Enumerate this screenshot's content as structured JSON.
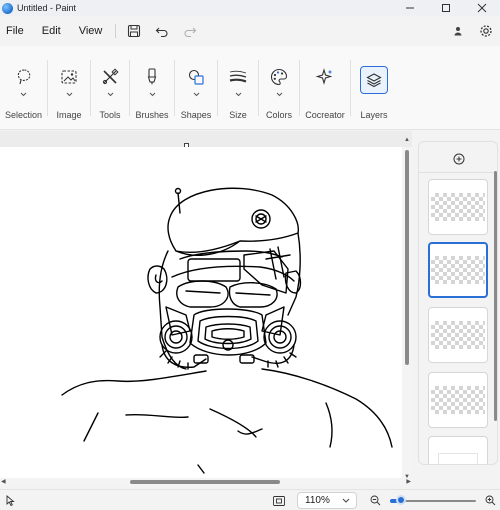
{
  "window": {
    "title": "Untitled - Paint",
    "controls": [
      "minimize",
      "maximize",
      "close"
    ]
  },
  "menu": {
    "items": [
      "File",
      "Edit",
      "View"
    ],
    "quick_actions": [
      "save-icon",
      "undo-icon",
      "redo-icon"
    ],
    "right_icons": [
      "account-icon",
      "settings-icon"
    ]
  },
  "ribbon": {
    "groups": [
      {
        "label": "Selection",
        "icon": "selection-lasso-icon",
        "has_dropdown": true
      },
      {
        "label": "Image",
        "icon": "image-icon",
        "has_dropdown": true
      },
      {
        "label": "Tools",
        "icon": "tools-icon",
        "has_dropdown": true
      },
      {
        "label": "Brushes",
        "icon": "brush-icon",
        "has_dropdown": true
      },
      {
        "label": "Shapes",
        "icon": "shapes-icon",
        "has_dropdown": true
      },
      {
        "label": "Size",
        "icon": "size-lines-icon",
        "has_dropdown": true
      },
      {
        "label": "Colors",
        "icon": "palette-icon",
        "has_dropdown": true
      },
      {
        "label": "Cocreator",
        "icon": "sparkle-icon",
        "has_dropdown": false
      },
      {
        "label": "Layers",
        "icon": "layers-icon",
        "has_dropdown": false,
        "active": true
      }
    ]
  },
  "layers_panel": {
    "add_icon": "add-layer-icon",
    "layers": [
      {
        "type": "transparent",
        "selected": false
      },
      {
        "type": "transparent",
        "selected": true
      },
      {
        "type": "transparent",
        "selected": false
      },
      {
        "type": "transparent",
        "selected": false
      },
      {
        "type": "white-background",
        "selected": false
      }
    ]
  },
  "statusbar": {
    "pointer_icon": "pointer-icon",
    "fit_icon": "fit-to-window-icon",
    "zoom_value": "110%",
    "zoom_level": 0.11,
    "zoom_out_icon": "zoom-out-icon",
    "zoom_in_icon": "zoom-in-icon"
  },
  "colors": {
    "accent": "#2a6fd6",
    "background": "#f3f3f3",
    "canvas": "#ffffff"
  }
}
